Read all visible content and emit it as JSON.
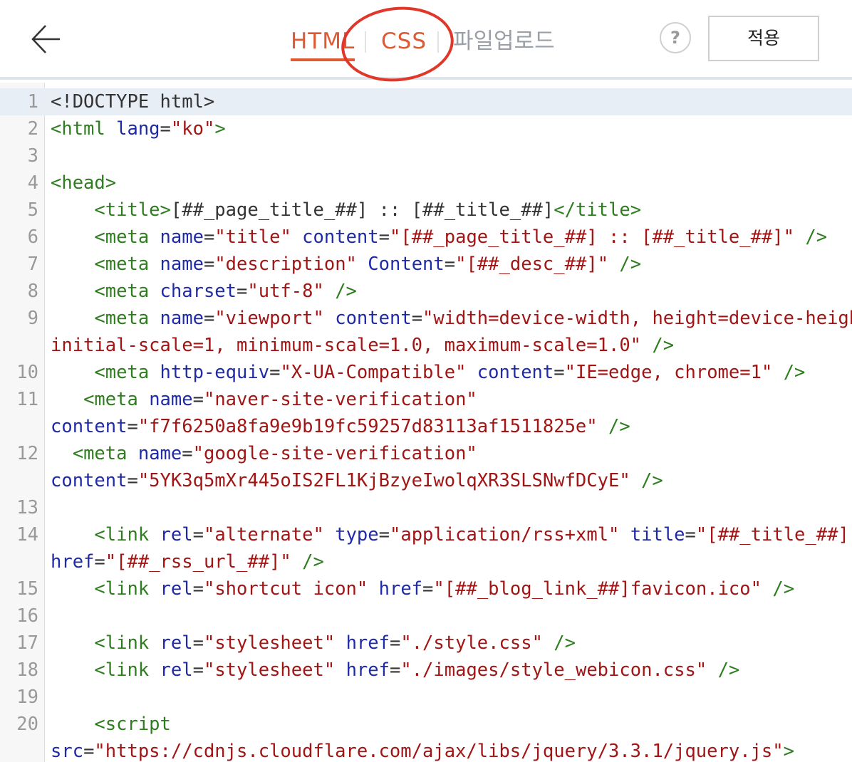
{
  "header": {
    "tabs": [
      {
        "label": "HTML",
        "active": true
      },
      {
        "label": "CSS",
        "active": false
      },
      {
        "label": "파일업로드",
        "active": false
      }
    ],
    "help_label": "?",
    "apply_label": "적용",
    "back_icon": "arrow-left-icon",
    "accent_color": "#df5a33",
    "annotation_color": "#e0372a"
  },
  "editor": {
    "lines": [
      {
        "n": "1",
        "tokens": [
          [
            "p",
            "<!DOCTYPE html>"
          ]
        ]
      },
      {
        "n": "2",
        "tokens": [
          [
            "t",
            "<html"
          ],
          [
            "p",
            " "
          ],
          [
            "a",
            "lang"
          ],
          [
            "p",
            "="
          ],
          [
            "s",
            "\"ko\""
          ],
          [
            "t",
            ">"
          ]
        ]
      },
      {
        "n": "3",
        "tokens": []
      },
      {
        "n": "4",
        "tokens": [
          [
            "t",
            "<head>"
          ]
        ]
      },
      {
        "n": "5",
        "tokens": [
          [
            "p",
            "    "
          ],
          [
            "t",
            "<title>"
          ],
          [
            "p",
            "[##_page_title_##] :: [##_title_##]"
          ],
          [
            "t",
            "</title>"
          ]
        ]
      },
      {
        "n": "6",
        "tokens": [
          [
            "p",
            "    "
          ],
          [
            "t",
            "<meta"
          ],
          [
            "p",
            " "
          ],
          [
            "a",
            "name"
          ],
          [
            "p",
            "="
          ],
          [
            "s",
            "\"title\""
          ],
          [
            "p",
            " "
          ],
          [
            "a",
            "content"
          ],
          [
            "p",
            "="
          ],
          [
            "s",
            "\"[##_page_title_##] :: [##_title_##]\""
          ],
          [
            "p",
            " "
          ],
          [
            "t",
            "/>"
          ]
        ]
      },
      {
        "n": "7",
        "tokens": [
          [
            "p",
            "    "
          ],
          [
            "t",
            "<meta"
          ],
          [
            "p",
            " "
          ],
          [
            "a",
            "name"
          ],
          [
            "p",
            "="
          ],
          [
            "s",
            "\"description\""
          ],
          [
            "p",
            " "
          ],
          [
            "a",
            "Content"
          ],
          [
            "p",
            "="
          ],
          [
            "s",
            "\"[##_desc_##]\""
          ],
          [
            "p",
            " "
          ],
          [
            "t",
            "/>"
          ]
        ]
      },
      {
        "n": "8",
        "tokens": [
          [
            "p",
            "    "
          ],
          [
            "t",
            "<meta"
          ],
          [
            "p",
            " "
          ],
          [
            "a",
            "charset"
          ],
          [
            "p",
            "="
          ],
          [
            "s",
            "\"utf-8\""
          ],
          [
            "p",
            " "
          ],
          [
            "t",
            "/>"
          ]
        ]
      },
      {
        "n": "9",
        "tokens": [
          [
            "p",
            "    "
          ],
          [
            "t",
            "<meta"
          ],
          [
            "p",
            " "
          ],
          [
            "a",
            "name"
          ],
          [
            "p",
            "="
          ],
          [
            "s",
            "\"viewport\""
          ],
          [
            "p",
            " "
          ],
          [
            "a",
            "content"
          ],
          [
            "p",
            "="
          ],
          [
            "s",
            "\"width=device-width, height=device-height,"
          ]
        ]
      },
      {
        "n": "",
        "tokens": [
          [
            "s",
            "initial-scale=1, minimum-scale=1.0, maximum-scale=1.0\""
          ],
          [
            "p",
            " "
          ],
          [
            "t",
            "/>"
          ]
        ]
      },
      {
        "n": "10",
        "tokens": [
          [
            "p",
            "    "
          ],
          [
            "t",
            "<meta"
          ],
          [
            "p",
            " "
          ],
          [
            "a",
            "http-equiv"
          ],
          [
            "p",
            "="
          ],
          [
            "s",
            "\"X-UA-Compatible\""
          ],
          [
            "p",
            " "
          ],
          [
            "a",
            "content"
          ],
          [
            "p",
            "="
          ],
          [
            "s",
            "\"IE=edge, chrome=1\""
          ],
          [
            "p",
            " "
          ],
          [
            "t",
            "/>"
          ]
        ]
      },
      {
        "n": "11",
        "tokens": [
          [
            "p",
            "   "
          ],
          [
            "t",
            "<meta"
          ],
          [
            "p",
            " "
          ],
          [
            "a",
            "name"
          ],
          [
            "p",
            "="
          ],
          [
            "s",
            "\"naver-site-verification\""
          ]
        ]
      },
      {
        "n": "",
        "tokens": [
          [
            "a",
            "content"
          ],
          [
            "p",
            "="
          ],
          [
            "s",
            "\"f7f6250a8fa9e9b19fc59257d83113af1511825e\""
          ],
          [
            "p",
            " "
          ],
          [
            "t",
            "/>"
          ]
        ]
      },
      {
        "n": "12",
        "tokens": [
          [
            "p",
            "  "
          ],
          [
            "t",
            "<meta"
          ],
          [
            "p",
            " "
          ],
          [
            "a",
            "name"
          ],
          [
            "p",
            "="
          ],
          [
            "s",
            "\"google-site-verification\""
          ]
        ]
      },
      {
        "n": "",
        "tokens": [
          [
            "a",
            "content"
          ],
          [
            "p",
            "="
          ],
          [
            "s",
            "\"5YK3q5mXr445oIS2FL1KjBzyeIwolqXR3SLSNwfDCyE\""
          ],
          [
            "p",
            " "
          ],
          [
            "t",
            "/>"
          ]
        ]
      },
      {
        "n": "13",
        "tokens": []
      },
      {
        "n": "14",
        "tokens": [
          [
            "p",
            "    "
          ],
          [
            "t",
            "<link"
          ],
          [
            "p",
            " "
          ],
          [
            "a",
            "rel"
          ],
          [
            "p",
            "="
          ],
          [
            "s",
            "\"alternate\""
          ],
          [
            "p",
            " "
          ],
          [
            "a",
            "type"
          ],
          [
            "p",
            "="
          ],
          [
            "s",
            "\"application/rss+xml\""
          ],
          [
            "p",
            " "
          ],
          [
            "a",
            "title"
          ],
          [
            "p",
            "="
          ],
          [
            "s",
            "\"[##_title_##]\""
          ]
        ]
      },
      {
        "n": "",
        "tokens": [
          [
            "a",
            "href"
          ],
          [
            "p",
            "="
          ],
          [
            "s",
            "\"[##_rss_url_##]\""
          ],
          [
            "p",
            " "
          ],
          [
            "t",
            "/>"
          ]
        ]
      },
      {
        "n": "15",
        "tokens": [
          [
            "p",
            "    "
          ],
          [
            "t",
            "<link"
          ],
          [
            "p",
            " "
          ],
          [
            "a",
            "rel"
          ],
          [
            "p",
            "="
          ],
          [
            "s",
            "\"shortcut icon\""
          ],
          [
            "p",
            " "
          ],
          [
            "a",
            "href"
          ],
          [
            "p",
            "="
          ],
          [
            "s",
            "\"[##_blog_link_##]favicon.ico\""
          ],
          [
            "p",
            " "
          ],
          [
            "t",
            "/>"
          ]
        ]
      },
      {
        "n": "16",
        "tokens": []
      },
      {
        "n": "17",
        "tokens": [
          [
            "p",
            "    "
          ],
          [
            "t",
            "<link"
          ],
          [
            "p",
            " "
          ],
          [
            "a",
            "rel"
          ],
          [
            "p",
            "="
          ],
          [
            "s",
            "\"stylesheet\""
          ],
          [
            "p",
            " "
          ],
          [
            "a",
            "href"
          ],
          [
            "p",
            "="
          ],
          [
            "s",
            "\"./style.css\""
          ],
          [
            "p",
            " "
          ],
          [
            "t",
            "/>"
          ]
        ]
      },
      {
        "n": "18",
        "tokens": [
          [
            "p",
            "    "
          ],
          [
            "t",
            "<link"
          ],
          [
            "p",
            " "
          ],
          [
            "a",
            "rel"
          ],
          [
            "p",
            "="
          ],
          [
            "s",
            "\"stylesheet\""
          ],
          [
            "p",
            " "
          ],
          [
            "a",
            "href"
          ],
          [
            "p",
            "="
          ],
          [
            "s",
            "\"./images/style_webicon.css\""
          ],
          [
            "p",
            " "
          ],
          [
            "t",
            "/>"
          ]
        ]
      },
      {
        "n": "19",
        "tokens": []
      },
      {
        "n": "20",
        "tokens": [
          [
            "p",
            "    "
          ],
          [
            "t",
            "<script"
          ]
        ]
      },
      {
        "n": "",
        "tokens": [
          [
            "a",
            "src"
          ],
          [
            "p",
            "="
          ],
          [
            "s",
            "\"https://cdnjs.cloudflare.com/ajax/libs/jquery/3.3.1/jquery.js\""
          ],
          [
            "t",
            ">"
          ]
        ]
      }
    ]
  }
}
